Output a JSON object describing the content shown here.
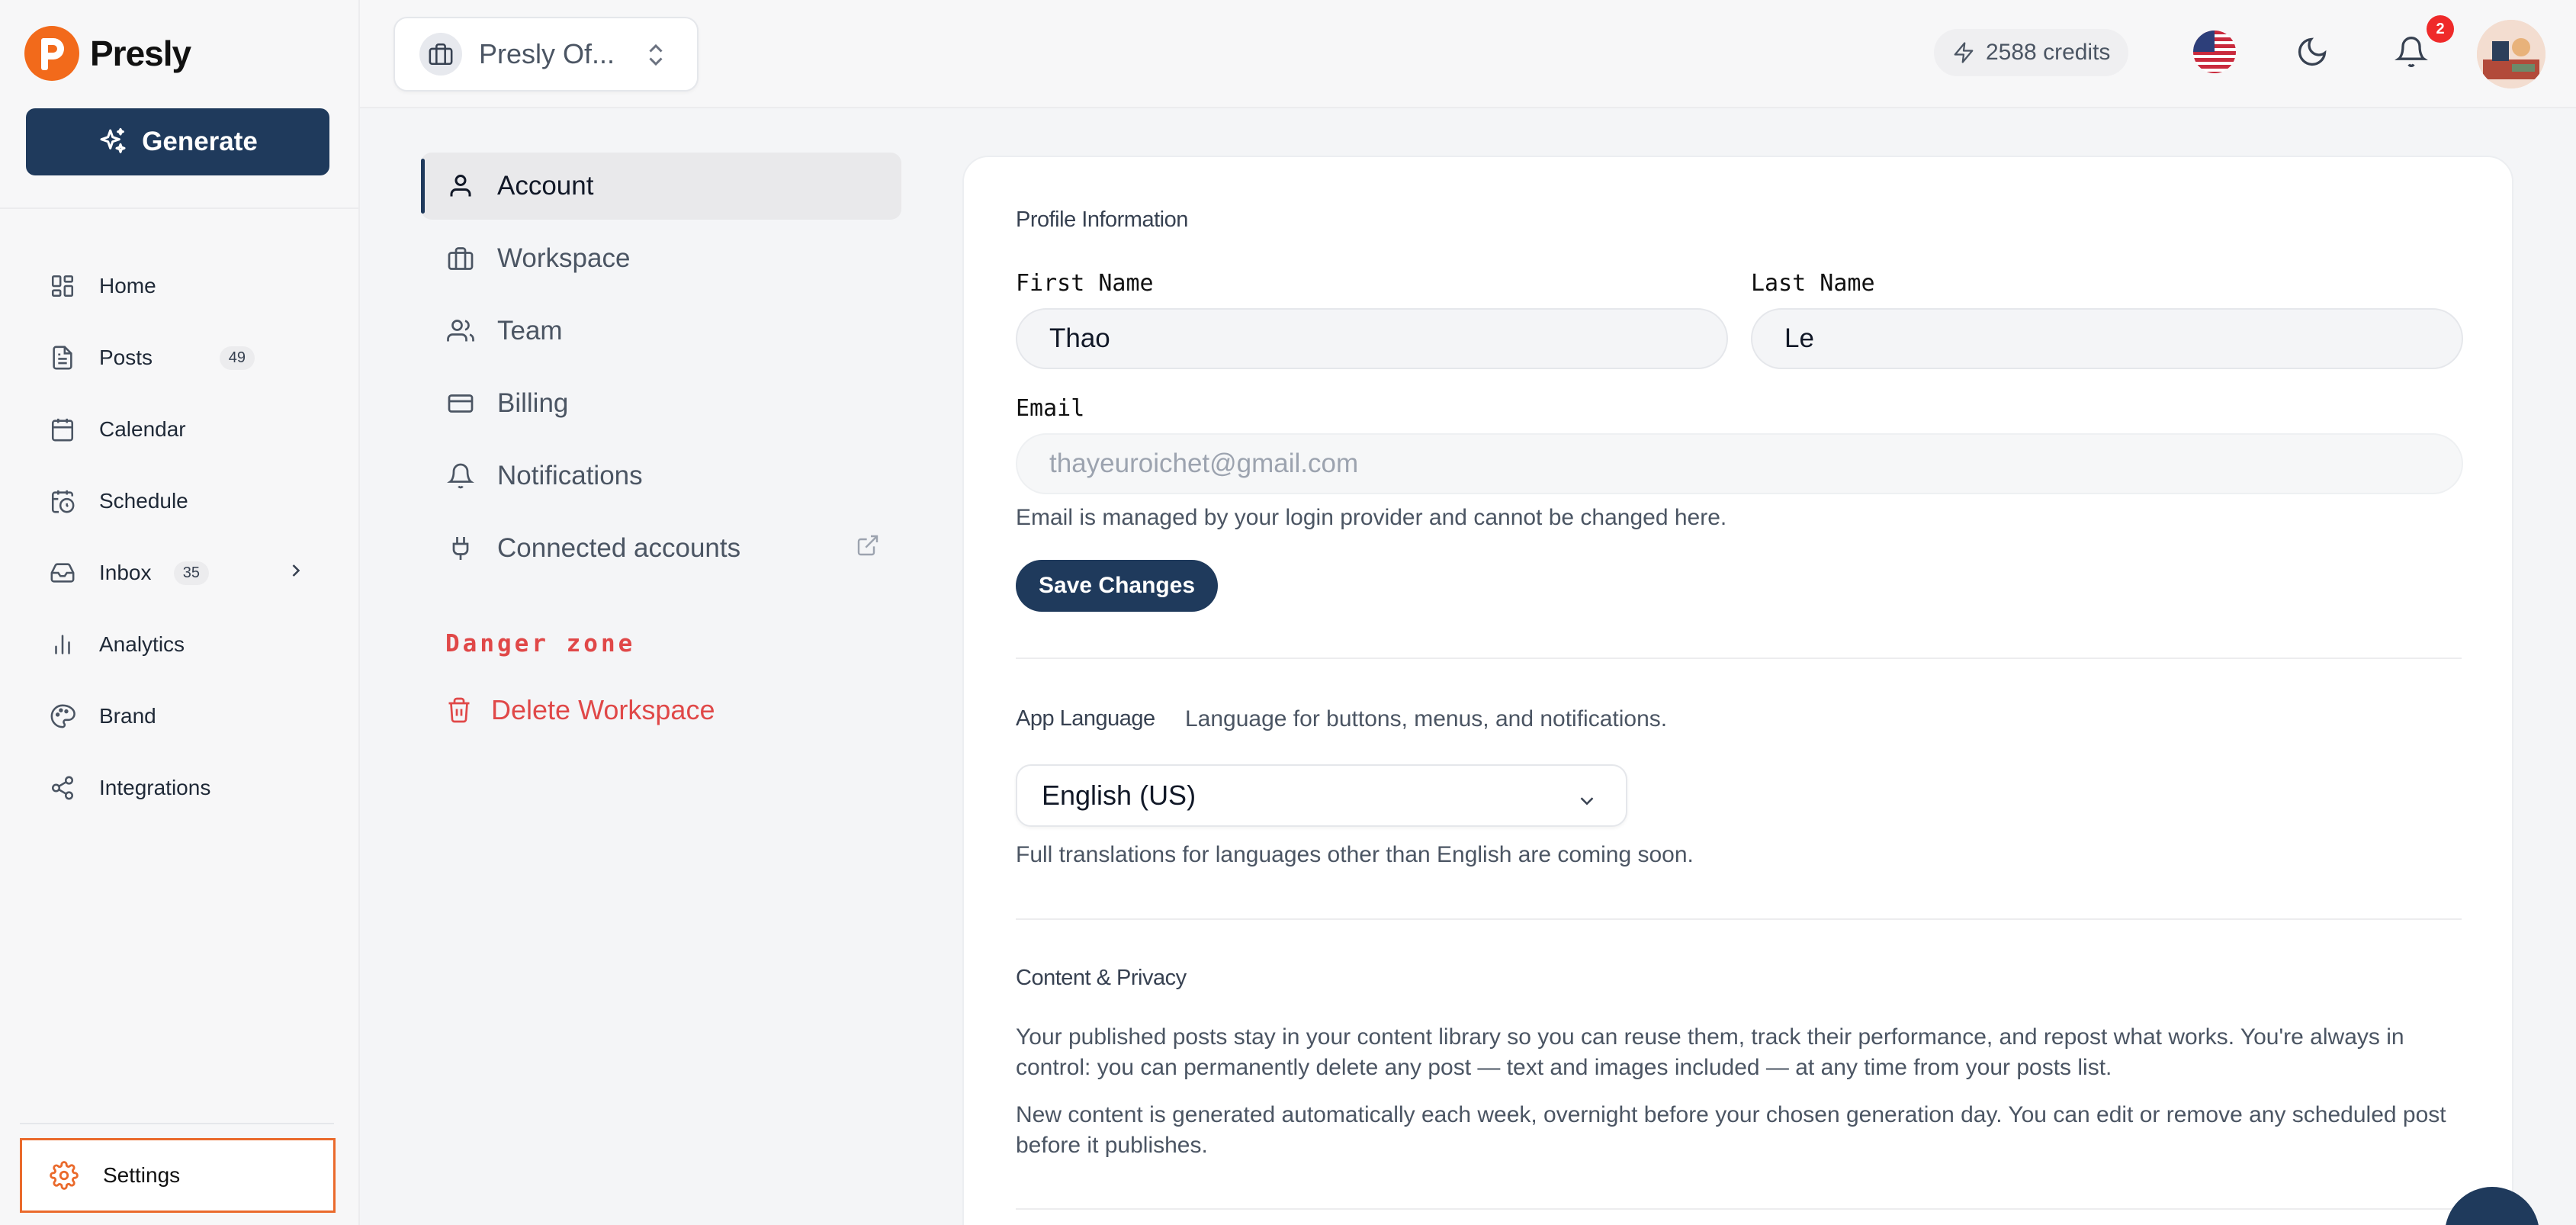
{
  "brand": {
    "name": "Presly",
    "accent": "#f26a1b",
    "primary": "#1f3a5c"
  },
  "sidebar": {
    "generate_label": "Generate",
    "items": [
      {
        "label": "Home",
        "icon": "layout-grid-icon"
      },
      {
        "label": "Posts",
        "icon": "document-icon",
        "badge": "49"
      },
      {
        "label": "Calendar",
        "icon": "calendar-icon"
      },
      {
        "label": "Schedule",
        "icon": "calendar-clock-icon"
      },
      {
        "label": "Inbox",
        "icon": "inbox-icon",
        "badge": "35"
      },
      {
        "label": "Analytics",
        "icon": "bar-chart-icon"
      },
      {
        "label": "Brand",
        "icon": "palette-icon"
      },
      {
        "label": "Integrations",
        "icon": "share-icon"
      }
    ],
    "settings_label": "Settings"
  },
  "topbar": {
    "workspace_name": "Presly Of...",
    "credits": "2588 credits",
    "notification_count": "2"
  },
  "settings_nav": {
    "items": [
      {
        "label": "Account",
        "active": true
      },
      {
        "label": "Workspace"
      },
      {
        "label": "Team"
      },
      {
        "label": "Billing"
      },
      {
        "label": "Notifications"
      },
      {
        "label": "Connected accounts"
      }
    ],
    "danger_title": "Danger zone",
    "delete_label": "Delete Workspace"
  },
  "profile": {
    "section_title": "Profile Information",
    "first_name_label": "First Name",
    "first_name": "Thao",
    "last_name_label": "Last Name",
    "last_name": "Le",
    "email_label": "Email",
    "email": "thayeuroichet@gmail.com",
    "email_help": "Email is managed by your login provider and cannot be changed here.",
    "save_label": "Save Changes"
  },
  "language": {
    "title": "App Language",
    "description": "Language for buttons, menus, and notifications.",
    "selected": "English (US)",
    "help": "Full translations for languages other than English are coming soon."
  },
  "privacy": {
    "title": "Content & Privacy",
    "paragraph1": "Your published posts stay in your content library so you can reuse them, track their performance, and repost what works. You're always in control: you can permanently delete any post — text and images included — at any time from your posts list.",
    "paragraph2": "New content is generated automatically each week, overnight before your chosen generation day. You can edit or remove any scheduled post before it publishes."
  }
}
